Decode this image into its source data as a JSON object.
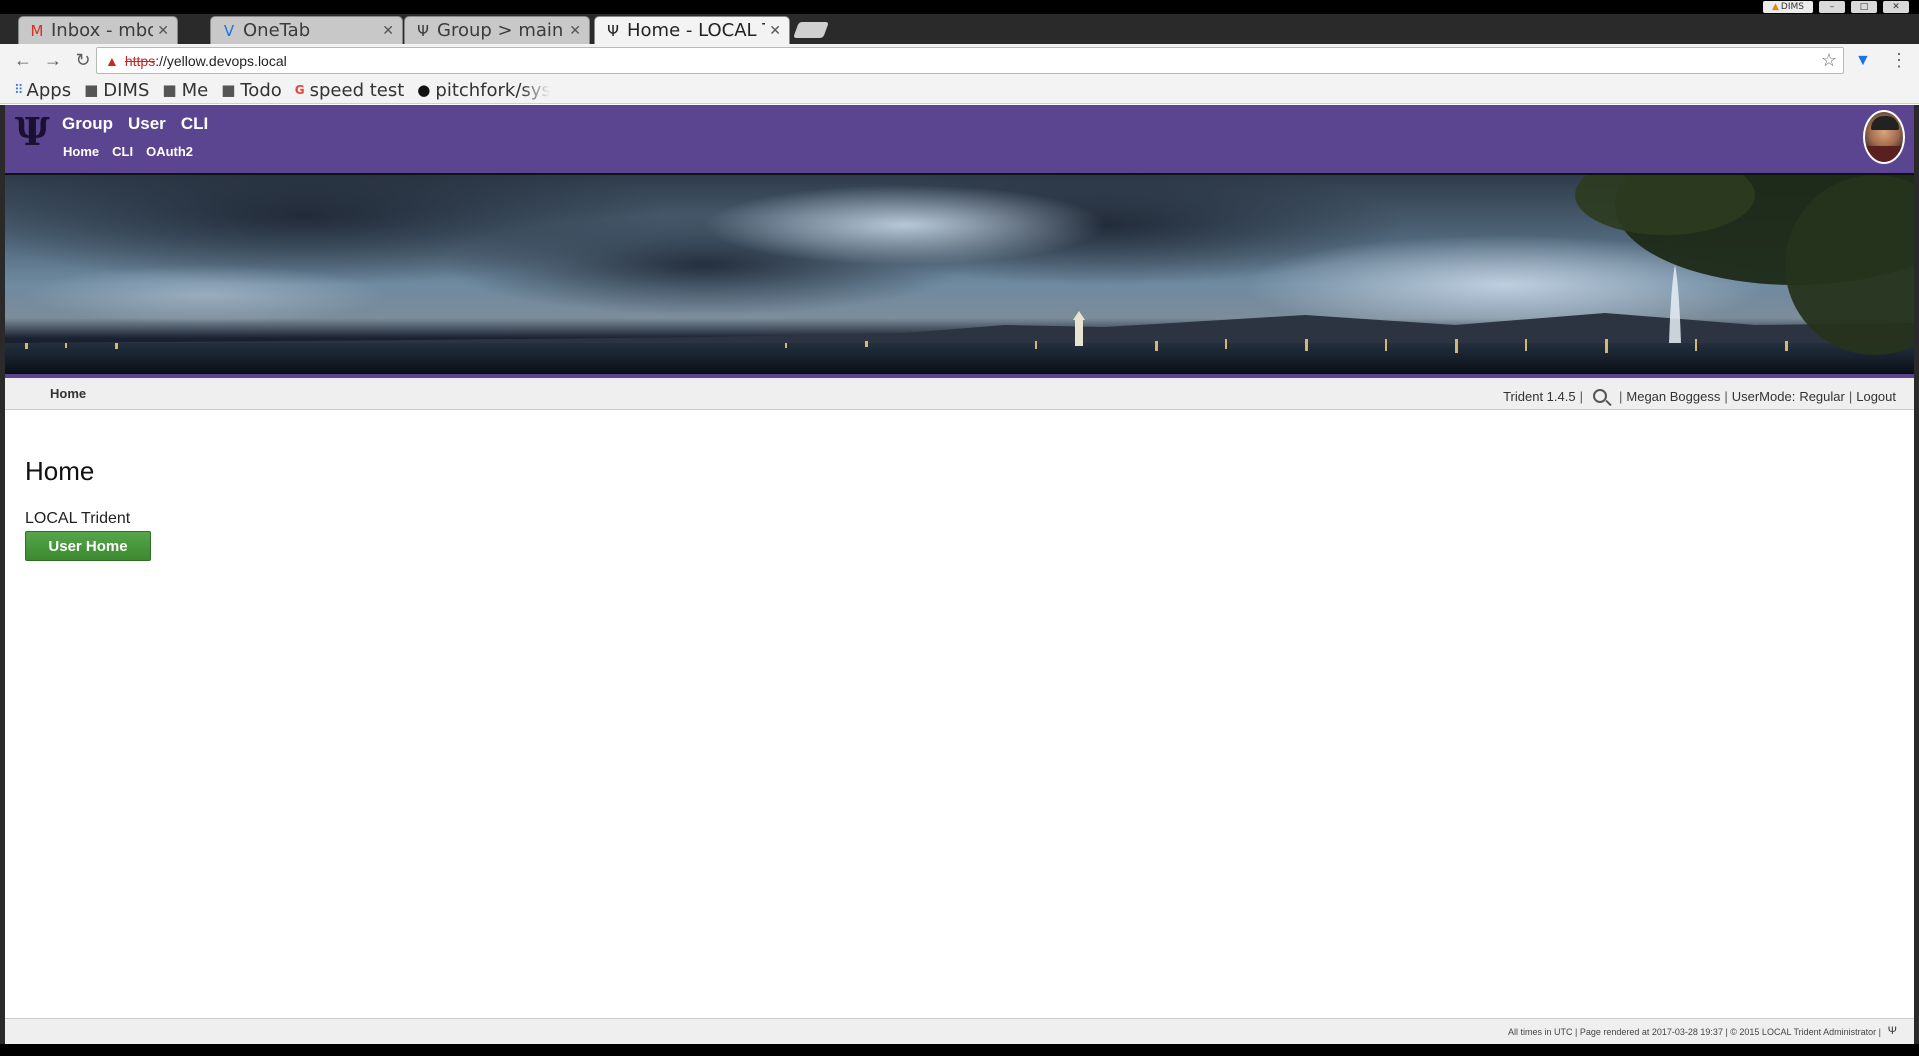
{
  "os": {
    "user": "DIMS"
  },
  "tabs": [
    {
      "icon": "gmail-icon",
      "glyph": "M",
      "label": "Inbox - mbogge",
      "active": false
    },
    {
      "icon": "onetab-icon",
      "glyph": "V",
      "label": "OneTab",
      "active": false
    },
    {
      "icon": "trident-icon",
      "glyph": "Ψ",
      "label": "Group > main > ",
      "active": false
    },
    {
      "icon": "trident-icon",
      "glyph": "Ψ",
      "label": "Home - LOCAL T",
      "active": true
    }
  ],
  "address": {
    "scheme": "https",
    "rest": "://yellow.devops.local"
  },
  "bookmarks": [
    {
      "icon": "apps-icon",
      "label": "Apps"
    },
    {
      "icon": "folder-icon",
      "label": "DIMS"
    },
    {
      "icon": "folder-icon",
      "label": "Me"
    },
    {
      "icon": "folder-icon",
      "label": "Todo"
    },
    {
      "icon": "google-icon",
      "label": "speed test"
    },
    {
      "icon": "github-icon",
      "label": "pitchfork/syst"
    }
  ],
  "site": {
    "logo": "Ψ",
    "mainnav": [
      "Group",
      "User",
      "CLI"
    ],
    "subnav": [
      "Home",
      "CLI",
      "OAuth2"
    ]
  },
  "infobar": {
    "crumb": "Home",
    "version": "Trident 1.4.5",
    "user_name": "Megan Boggess",
    "usermode_label": "UserMode:",
    "usermode_value": "Regular",
    "logout": "Logout"
  },
  "content": {
    "title": "Home",
    "description": "LOCAL Trident",
    "button": "User Home"
  },
  "footer": {
    "text": "All times in UTC | Page rendered at 2017-03-28 19:37 | © 2015 LOCAL Trident Administrator |",
    "logo": "Ψ"
  },
  "colors": {
    "header": "#5b4490",
    "button": "#4a9a3e"
  }
}
